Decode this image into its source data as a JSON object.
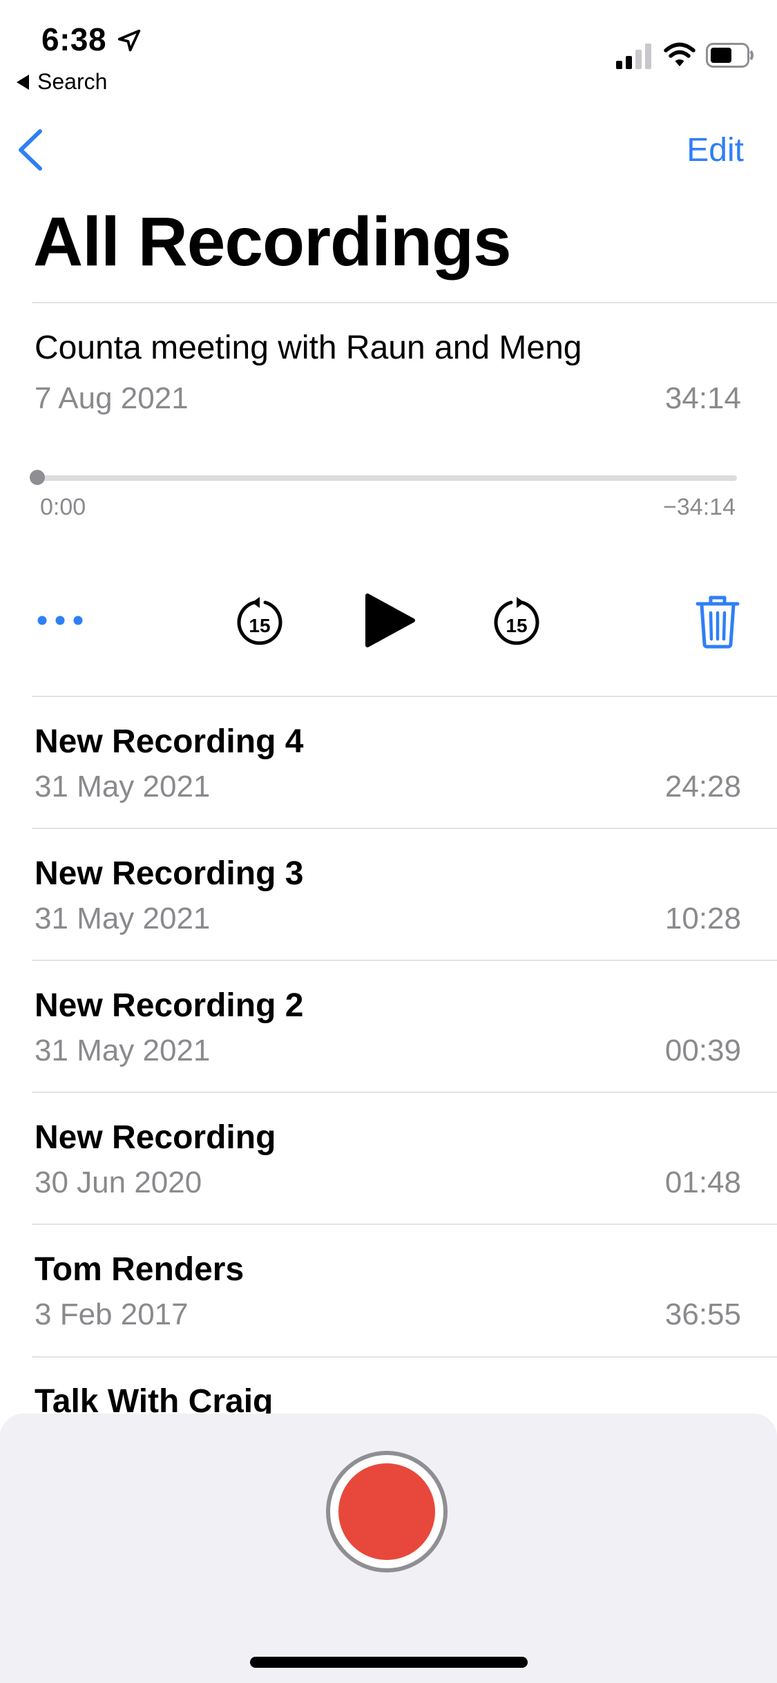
{
  "status_bar": {
    "time": "6:38",
    "back_app": "Search"
  },
  "nav": {
    "edit_label": "Edit",
    "title": "All Recordings"
  },
  "expanded": {
    "title": "Counta meeting with Raun and Meng",
    "date": "7 Aug 2021",
    "duration": "34:14",
    "elapsed": "0:00",
    "remaining": "−34:14",
    "progress": 0
  },
  "recordings": [
    {
      "title": "New Recording 4",
      "date": "31 May 2021",
      "duration": "24:28"
    },
    {
      "title": "New Recording 3",
      "date": "31 May 2021",
      "duration": "10:28"
    },
    {
      "title": "New Recording 2",
      "date": "31 May 2021",
      "duration": "00:39"
    },
    {
      "title": "New Recording",
      "date": "30 Jun 2020",
      "duration": "01:48"
    },
    {
      "title": "Tom Renders",
      "date": "3 Feb 2017",
      "duration": "36:55"
    },
    {
      "title": "Talk With Craig"
    }
  ],
  "colors": {
    "accent": "#2f7ff6",
    "record": "#e8483c",
    "secondary_text": "#8a8a8e"
  }
}
